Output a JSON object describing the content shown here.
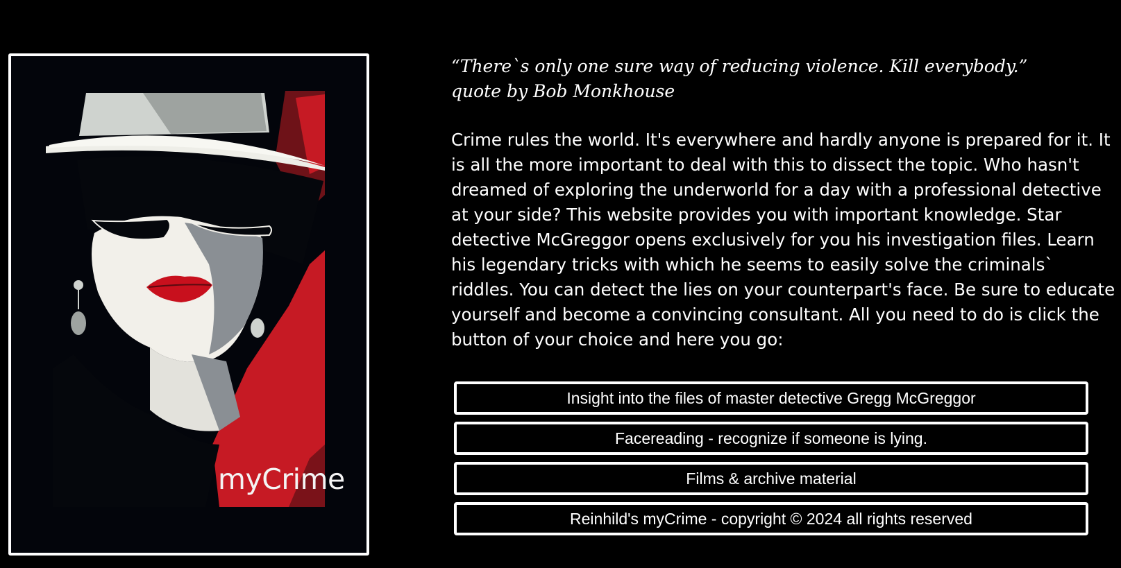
{
  "poster": {
    "logo_text": "myCrime",
    "colors": {
      "background": "#03050b",
      "hat": "#e9ece9",
      "red": "#c61a24",
      "dark_red": "#6e1218",
      "skin": "#f2f0ea",
      "grey": "#8a8f94"
    }
  },
  "quote": {
    "line1": "“There`s only one sure way of reducing violence. Kill everybody.”",
    "line2": "quote by Bob Monkhouse"
  },
  "intro_text": "Crime rules the world. It's everywhere and hardly anyone is prepared for it. It is all the more important to deal with this to dissect the topic. Who hasn't dreamed of exploring the underworld for a day with a professional detective at your side? This website provides you with important knowledge. Star detective McGreggor opens exclusively for you his investigation files. Learn his legendary tricks with which he seems to easily solve the criminals` riddles. You can detect the lies on your counterpart's face. Be sure to educate yourself and become a convincing consultant. All you need to do is click the button of your choice and here you go:",
  "buttons": [
    {
      "label": "Insight into the files of master detective Gregg McGreggor"
    },
    {
      "label": "Facereading - recognize if someone is lying."
    },
    {
      "label": "Films & archive material"
    },
    {
      "label": "Reinhild's myCrime - copyright © 2024 all rights reserved"
    }
  ]
}
